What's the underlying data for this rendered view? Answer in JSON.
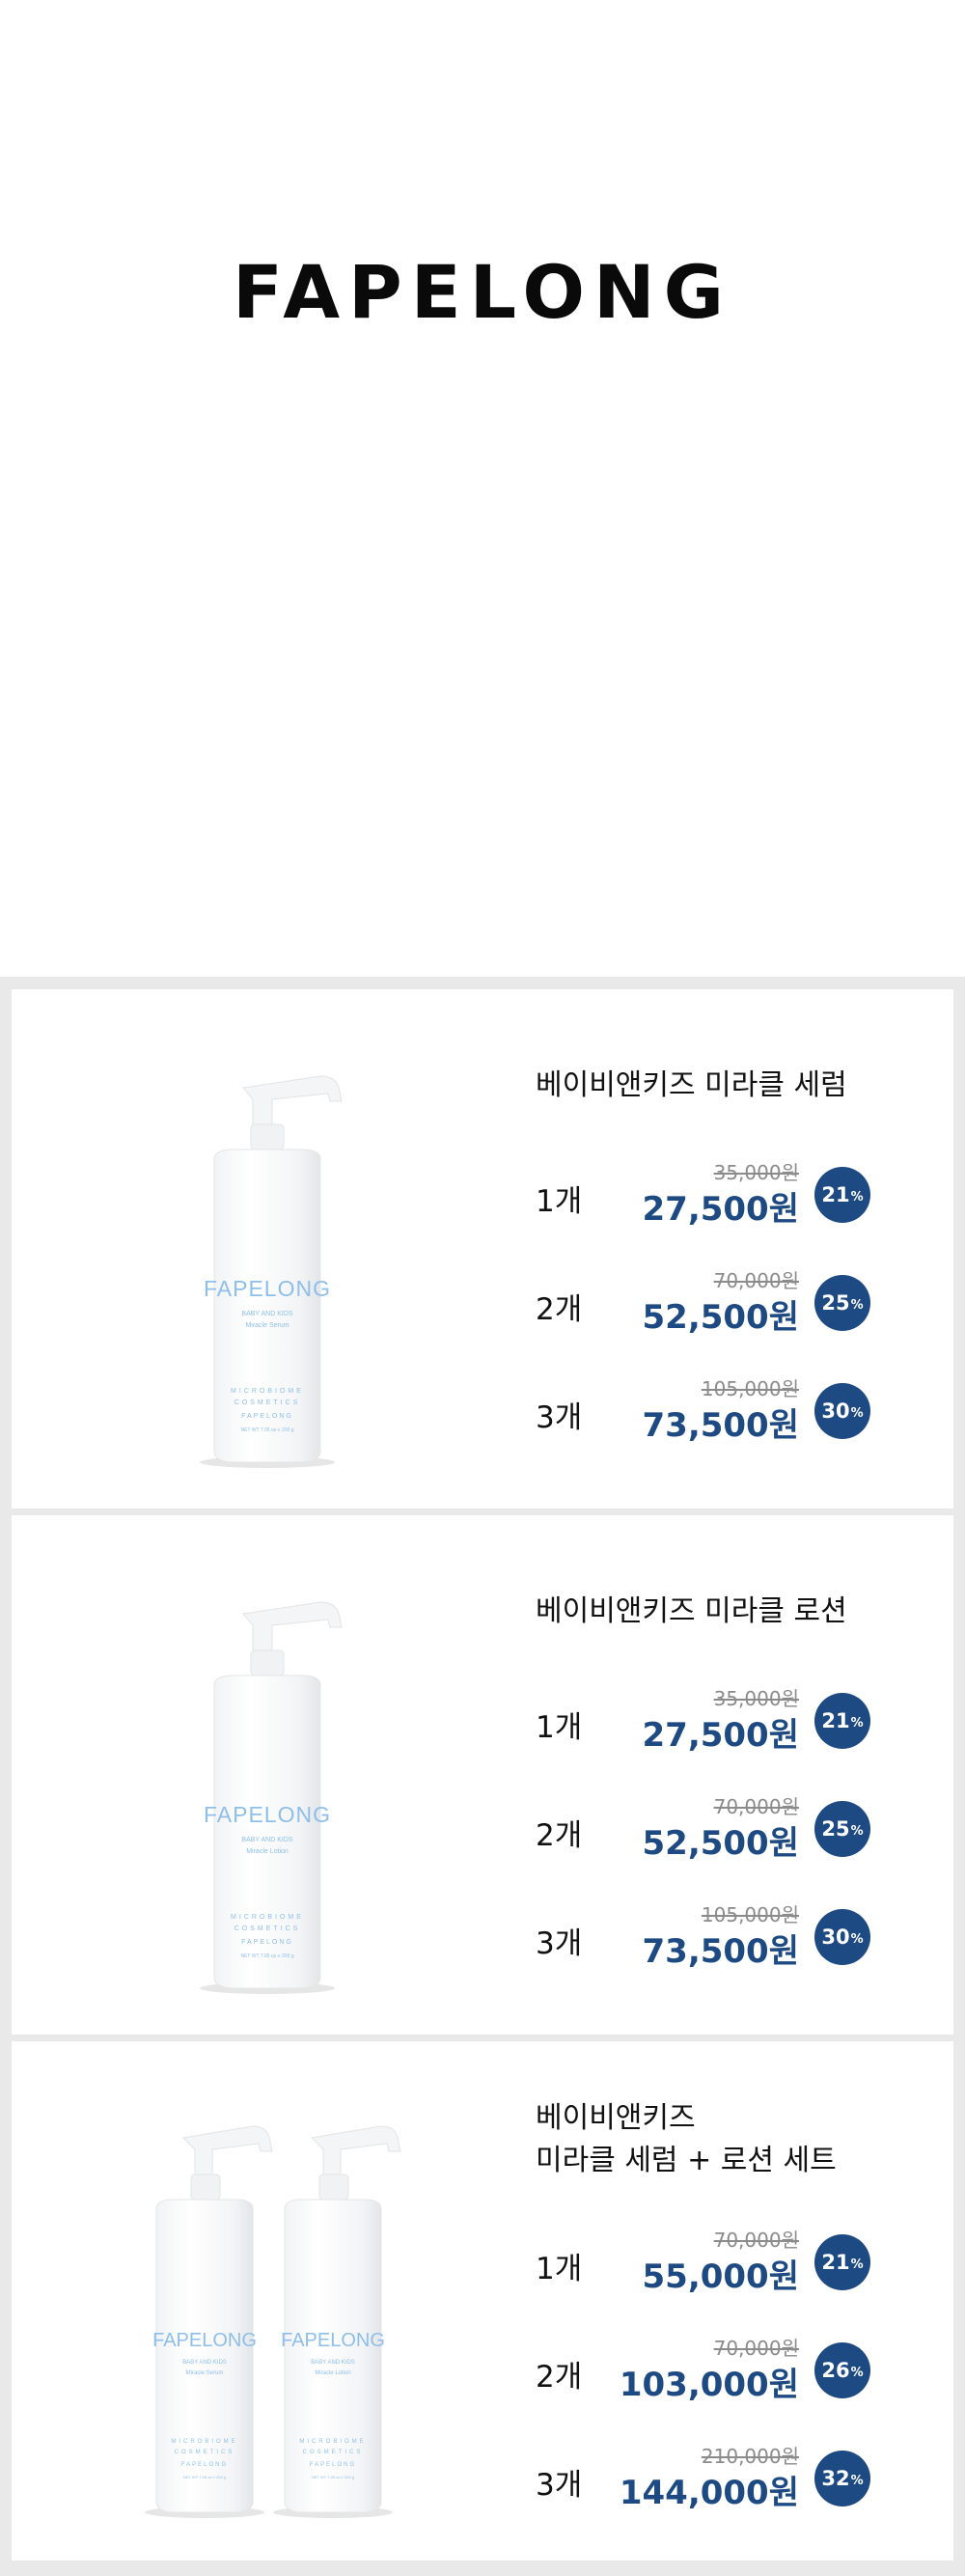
{
  "brand": "FAPELONG",
  "products": [
    {
      "title": "베이비앤키즈 미라클 세럼",
      "bottle_text": {
        "brand": "FAPELONG",
        "line1": "BABY AND KIDS",
        "line2": "Miracle Serum",
        "line3": "MICROBIOME",
        "line4": "COSMETICS",
        "line5": "FAPELONG",
        "line6": "NET WT 7.05 oz  ℮ 200 g"
      },
      "options": [
        {
          "qty": "1개",
          "original": "35,000원",
          "price": "27,500원",
          "discount": "21",
          "unit": "%"
        },
        {
          "qty": "2개",
          "original": "70,000원",
          "price": "52,500원",
          "discount": "25",
          "unit": "%"
        },
        {
          "qty": "3개",
          "original": "105,000원",
          "price": "73,500원",
          "discount": "30",
          "unit": "%"
        }
      ]
    },
    {
      "title": "베이비앤키즈 미라클 로션",
      "bottle_text": {
        "brand": "FAPELONG",
        "line1": "BABY AND KIDS",
        "line2": "Miracle Lotion",
        "line3": "MICROBIOME",
        "line4": "COSMETICS",
        "line5": "FAPELONG",
        "line6": "NET WT 7.05 oz  ℮ 200 g"
      },
      "options": [
        {
          "qty": "1개",
          "original": "35,000원",
          "price": "27,500원",
          "discount": "21",
          "unit": "%"
        },
        {
          "qty": "2개",
          "original": "70,000원",
          "price": "52,500원",
          "discount": "25",
          "unit": "%"
        },
        {
          "qty": "3개",
          "original": "105,000원",
          "price": "73,500원",
          "discount": "30",
          "unit": "%"
        }
      ]
    },
    {
      "title": "베이비앤키즈\n미라클 세럼 + 로션 세트",
      "bottle_text": {
        "brand": "FAPELONG",
        "line1": "BABY AND KIDS",
        "line2": "Miracle Serum",
        "line2b": "Miracle Lotion",
        "line3": "MICROBIOME",
        "line4": "COSMETICS",
        "line5": "FAPELONG",
        "line6": "NET WT 7.05 oz  ℮ 200 g"
      },
      "options": [
        {
          "qty": "1개",
          "original": "70,000원",
          "price": "55,000원",
          "discount": "21",
          "unit": "%"
        },
        {
          "qty": "2개",
          "original": "70,000원",
          "price": "103,000원",
          "discount": "26",
          "unit": "%"
        },
        {
          "qty": "3개",
          "original": "210,000원",
          "price": "144,000원",
          "discount": "32",
          "unit": "%"
        }
      ]
    }
  ],
  "colors": {
    "price": "#1d4a83",
    "badge": "#1d4a83",
    "bottle_text": "#8dbfea",
    "strike": "#8b8b8b"
  }
}
